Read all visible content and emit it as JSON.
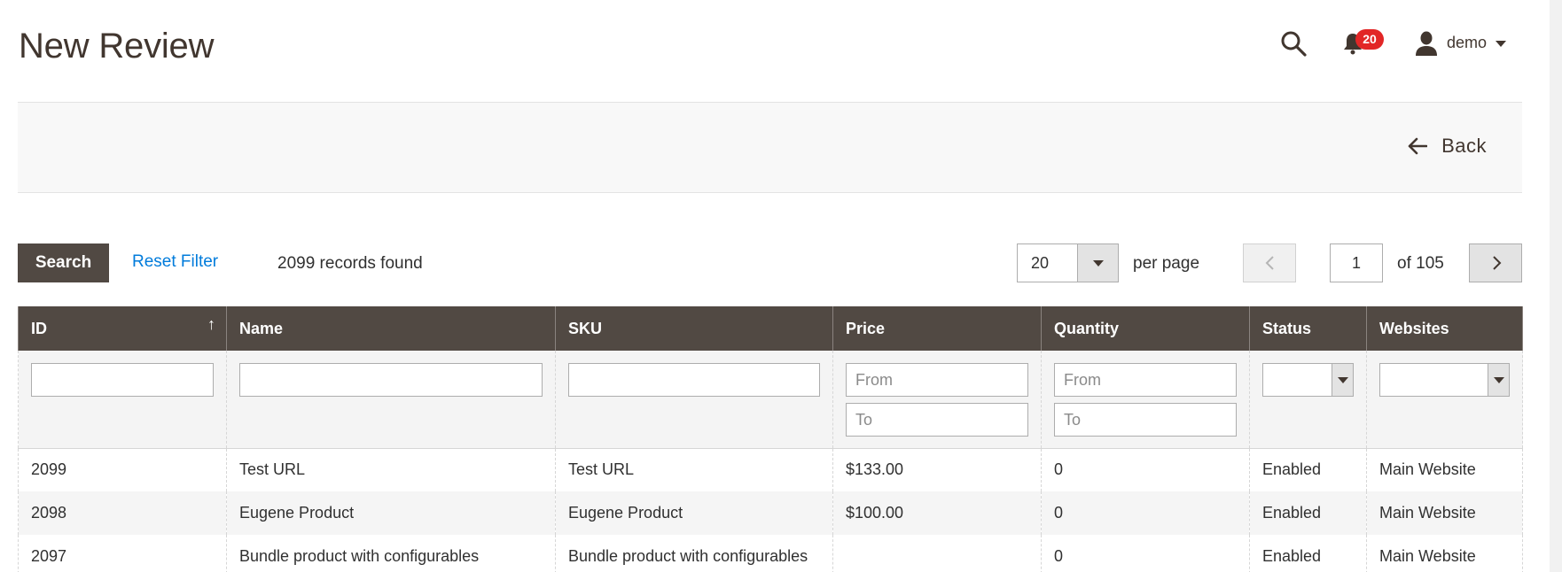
{
  "header": {
    "page_title": "New Review",
    "notifications_count": "20",
    "user_name": "demo"
  },
  "action_bar": {
    "back_label": "Back"
  },
  "grid_controls": {
    "search_label": "Search",
    "reset_label": "Reset Filter",
    "records_found": "2099 records found",
    "per_page_value": "20",
    "per_page_label": "per page",
    "current_page": "1",
    "of_pages": "of 105"
  },
  "table": {
    "columns": [
      "ID",
      "Name",
      "SKU",
      "Price",
      "Quantity",
      "Status",
      "Websites"
    ],
    "sort_indicator": "↑",
    "filters": {
      "price_from_placeholder": "From",
      "price_to_placeholder": "To",
      "qty_from_placeholder": "From",
      "qty_to_placeholder": "To"
    },
    "rows": [
      [
        "2099",
        "Test URL",
        "Test URL",
        "$133.00",
        "0",
        "Enabled",
        "Main Website"
      ],
      [
        "2098",
        "Eugene Product",
        "Eugene Product",
        "$100.00",
        "0",
        "Enabled",
        "Main Website"
      ],
      [
        "2097",
        "Bundle product with configurables",
        "Bundle product with configurables",
        "",
        "0",
        "Enabled",
        "Main Website"
      ]
    ]
  },
  "icons": {
    "search": "search-icon",
    "notifications": "bell-icon",
    "user": "user-icon",
    "back": "arrow-left-icon",
    "prev": "chevron-left-icon",
    "next": "chevron-right-icon"
  },
  "colors": {
    "header_dark": "#514943",
    "link_blue": "#007bdb",
    "badge_red": "#e22626",
    "title_brown": "#41362f"
  }
}
